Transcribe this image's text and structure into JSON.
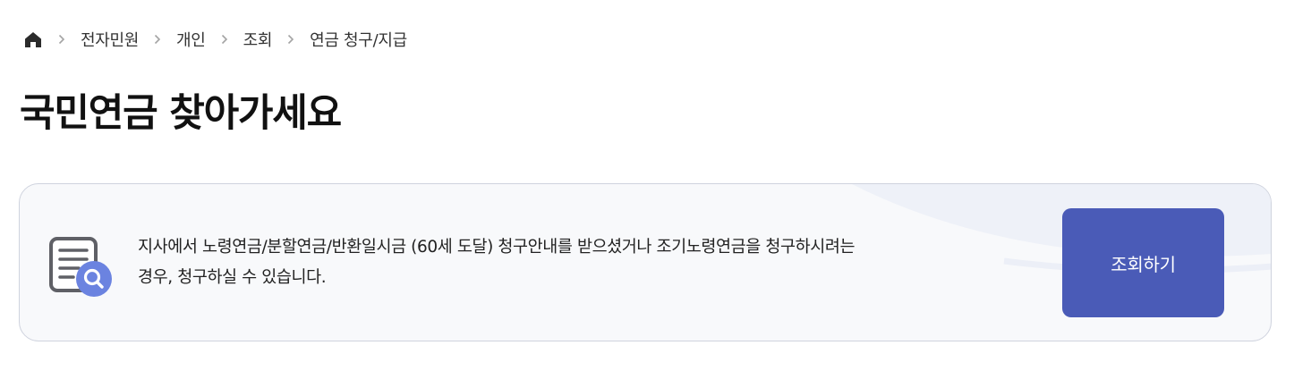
{
  "breadcrumb": {
    "home_icon": "home-icon",
    "separator_icon": "chevron-right-icon",
    "items": [
      "전자민원",
      "개인",
      "조회",
      "연금 청구/지급"
    ]
  },
  "page": {
    "title": "국민연금 찾아가세요"
  },
  "card": {
    "icon": "document-search-icon",
    "text_line1": "지사에서 노령연금/분할연금/반환일시금 (60세 도달) 청구안내를 받으셨거나 조기노령연금을 청구하시려는",
    "text_line2": "경우, 청구하실 수 있습니다.",
    "button_label": "조회하기"
  },
  "colors": {
    "accent": "#4a5bb7",
    "icon_badge": "#6b83e0",
    "card_bg": "#f8f9fb",
    "card_border": "#cfd3de"
  }
}
